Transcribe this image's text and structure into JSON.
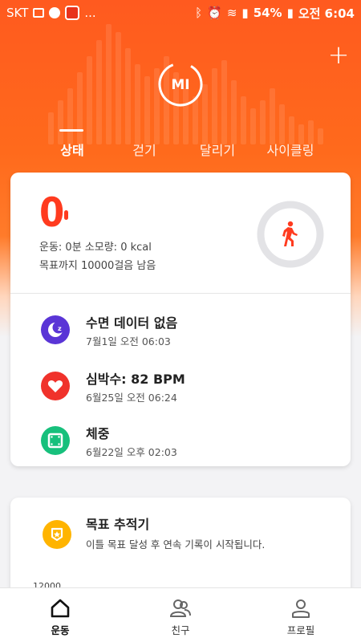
{
  "status_bar": {
    "carrier": "SKT",
    "more": "...",
    "battery": "54%",
    "time": "오전 6:04"
  },
  "header": {
    "add_label": "+",
    "logo_text": "MI"
  },
  "tabs": [
    {
      "label": "상태",
      "active": true
    },
    {
      "label": "걷기",
      "active": false
    },
    {
      "label": "달리기",
      "active": false
    },
    {
      "label": "사이클링",
      "active": false
    }
  ],
  "activity": {
    "steps": "0",
    "summary": "운동: 0분 소모량: 0 kcal",
    "goal_remaining": "목표까지 10000걸음 남음",
    "ring_progress": 0
  },
  "health_rows": [
    {
      "title": "수면 데이터 없음",
      "subtitle": "7월1일 오전 06:03",
      "icon": "sleep-moon-icon",
      "color": "#5a35d6"
    },
    {
      "title": "심박수: 82 BPM",
      "subtitle": "6월25일 오전 06:24",
      "icon": "heart-icon",
      "color": "#f0322b"
    },
    {
      "title": "체중",
      "subtitle": "6월22일 오후 02:03",
      "icon": "scale-icon",
      "color": "#17c07c"
    }
  ],
  "tracker": {
    "title": "목표 추적기",
    "subtitle": "이틀 목표 달성 후 연속 기록이 시작됩니다.",
    "axis_value": "12000",
    "icon": "badge-icon",
    "color": "#ffb400"
  },
  "bottom_nav": [
    {
      "label": "운동",
      "icon": "home-icon",
      "active": true
    },
    {
      "label": "친구",
      "icon": "friends-icon",
      "active": false
    },
    {
      "label": "프로필",
      "icon": "profile-icon",
      "active": false
    }
  ],
  "colors": {
    "accent": "#ff5a1f",
    "step_red": "#ff3b1f"
  }
}
